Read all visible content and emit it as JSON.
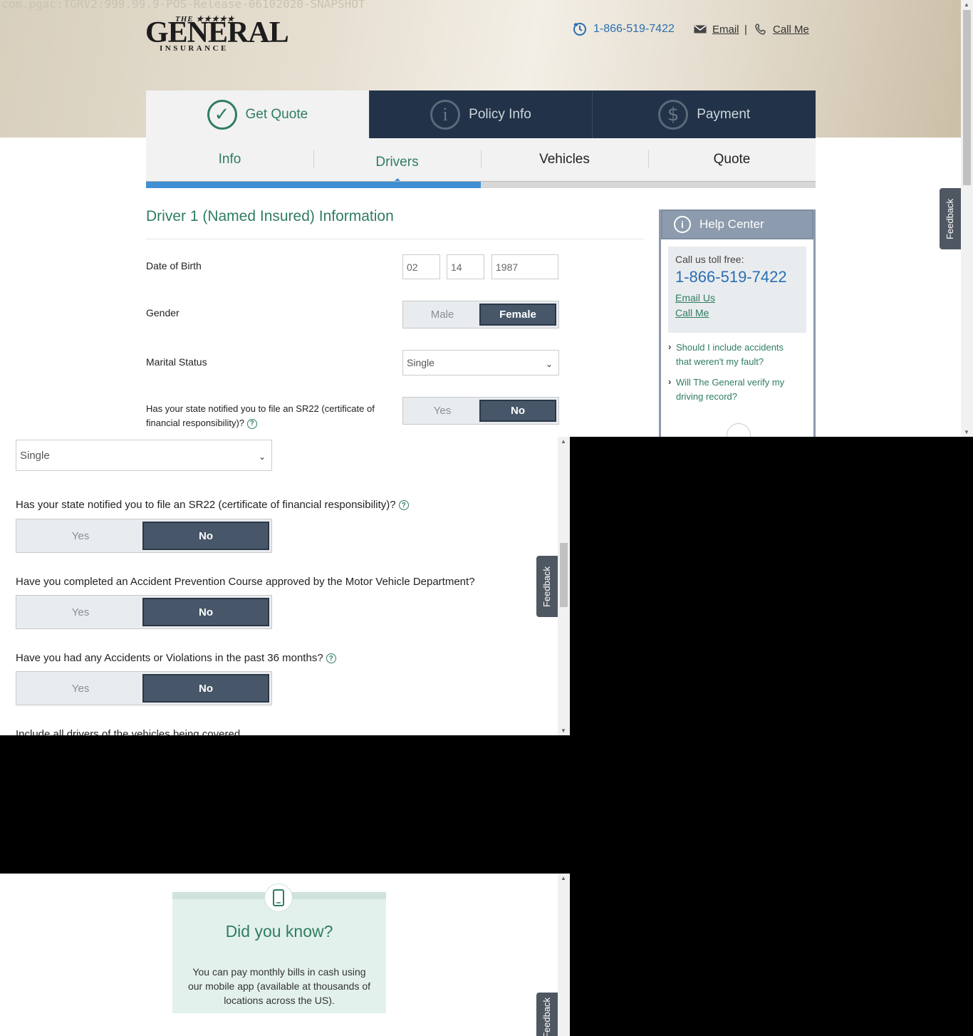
{
  "watermark": "com.pgac:TGRV2:999.99.9-POS-Release-06102020-SNAPSHOT",
  "logo": {
    "the": "THE ★★★★★",
    "main": "GENERAL",
    "sub": "INSURANCE"
  },
  "header": {
    "phone": "1-866-519-7422",
    "email_label": "Email",
    "divider": "|",
    "call_label": "Call Me"
  },
  "steps": [
    {
      "label": "Get Quote",
      "icon": "check-icon"
    },
    {
      "label": "Policy Info",
      "icon": "info-icon"
    },
    {
      "label": "Payment",
      "icon": "dollar-icon"
    }
  ],
  "subtabs": [
    "Info",
    "Drivers",
    "Vehicles",
    "Quote"
  ],
  "progress_fraction": 0.5,
  "form": {
    "title": "Driver 1 (Named Insured) Information",
    "dob_label": "Date of Birth",
    "dob": {
      "month": "02",
      "day": "14",
      "year": "1987"
    },
    "gender_label": "Gender",
    "gender_options": [
      "Male",
      "Female"
    ],
    "gender_selected": "Female",
    "marital_label": "Marital Status",
    "marital_value": "Single",
    "sr22_label_line1": "Has your state notified you to file an SR22 (certificate of",
    "sr22_label_line2": "financial responsibility)?",
    "yes": "Yes",
    "no": "No"
  },
  "help": {
    "title": "Help Center",
    "toll_label": "Call us toll free:",
    "phone": "1-866-519-7422",
    "email_link": "Email Us",
    "call_link": "Call Me",
    "faq": [
      {
        "l1": "Should I include accidents",
        "l2": "that weren't my fault?"
      },
      {
        "l1": "Will The General verify my",
        "l2": "driving record?"
      }
    ]
  },
  "feedback": "Feedback",
  "mobile": {
    "marital_value": "Single",
    "sr22_question": "Has your state notified you to file an SR22 (certificate of financial responsibility)?",
    "course_question": "Have you completed an Accident Prevention Course approved by the Motor Vehicle Department?",
    "accidents_question": "Have you had any Accidents or Violations in the past 36 months?",
    "include_note": "Include all drivers of the vehicles being covered",
    "yes": "Yes",
    "no": "No"
  },
  "did_you_know": {
    "title": "Did you know?",
    "line1": "You can pay monthly bills in cash using",
    "line2": "our mobile app (available at thousands of",
    "line3": "locations across the US)."
  },
  "colors": {
    "green": "#2f7d60",
    "navy": "#223248",
    "blue": "#2a6eb2",
    "toggle_on": "#475669"
  }
}
